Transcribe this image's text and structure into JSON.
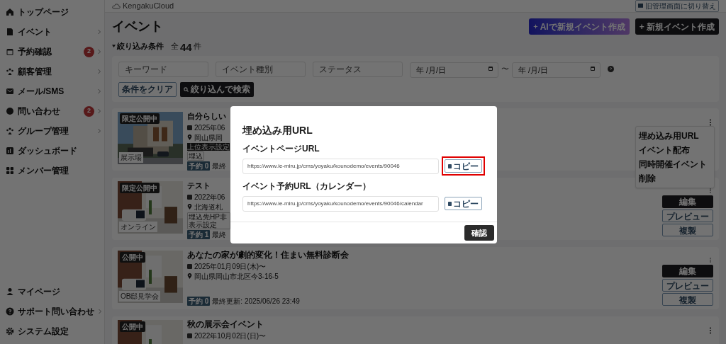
{
  "header": {
    "logo": "KengakuCloud",
    "switch_button": "旧管理画面に切り替え"
  },
  "sidebar": {
    "items": [
      {
        "label": "トップページ",
        "kind": "home",
        "chevron": false
      },
      {
        "label": "イベント",
        "kind": "doc",
        "chevron": true
      },
      {
        "label": "予約確認",
        "kind": "calendar",
        "chevron": true,
        "badge": "2"
      },
      {
        "label": "顧客管理",
        "kind": "users",
        "chevron": true
      },
      {
        "label": "メール/SMS",
        "kind": "mail",
        "chevron": true
      },
      {
        "label": "問い合わせ",
        "kind": "chat",
        "chevron": true,
        "badge": "2"
      },
      {
        "label": "グループ管理",
        "kind": "users",
        "chevron": true
      },
      {
        "label": "ダッシュボード",
        "kind": "chart",
        "chevron": false
      },
      {
        "label": "メンバー管理",
        "kind": "grid",
        "chevron": false
      }
    ],
    "bottom_items": [
      {
        "label": "マイページ",
        "kind": "user",
        "chevron": false
      },
      {
        "label": "サポート問い合わせ",
        "kind": "help",
        "chevron": true
      },
      {
        "label": "システム設定",
        "kind": "gear",
        "chevron": false
      }
    ]
  },
  "page": {
    "title": "イベント",
    "ai_button": "AIで新規イベント作成",
    "new_button": "+ 新規イベント作成",
    "filter_toggle": "絞り込み条件",
    "total_prefix": "全",
    "total": "44",
    "total_suffix": "件"
  },
  "filters": {
    "keyword": {
      "placeholder": "キーワード"
    },
    "event_type": {
      "placeholder": "イベント種別"
    },
    "status": {
      "placeholder": "ステータス"
    },
    "date_from": {
      "placeholder": "年 /月/日"
    },
    "range_sep": "〜",
    "date_to": {
      "placeholder": "年 /月/日"
    },
    "clear_button": "条件をクリア",
    "search_button": "絞り込んで検索"
  },
  "events": [
    {
      "status": "限定公開中",
      "venue": "展示場",
      "title": "自分らしい",
      "date": "2025年06",
      "location": "岡山県岡",
      "tags": [
        {
          "label": "上位表示設定",
          "kind": "dark"
        },
        {
          "label": "埋込",
          "kind": "outline"
        }
      ],
      "reservation": "予約 0",
      "updated": "最終",
      "menu": [
        "埋め込み用URL",
        "イベント配布",
        "同時開催イベント",
        "削除"
      ]
    },
    {
      "status": "限定公開中",
      "venue": "オンライン",
      "title": "テスト",
      "date": "2022年06",
      "location": "北海道札",
      "tags": [
        {
          "label": "埋込先HP非表示設定",
          "kind": "outline"
        }
      ],
      "reservation": "予約 1",
      "updated": "最終",
      "actions": [
        "編集",
        "プレビュー",
        "複製"
      ]
    },
    {
      "status": "公開中",
      "venue": "OB邸見学会",
      "title": "あなたの家が劇的変化！住まい無料診断会",
      "date": "2025年01月09日(木)〜",
      "location": "岡山県岡山市北区今3-16-5",
      "reservation": "予約 0",
      "updated": "最終更新: 2025/06/26 23:49",
      "actions": [
        "編集",
        "プレビュー",
        "複製"
      ]
    },
    {
      "status": "公開中",
      "title": "秋の展示会イベント",
      "date": "2022年10月02日(日)〜"
    }
  ],
  "modal": {
    "title": "埋め込み用URL",
    "fields": [
      {
        "label": "イベントページURL",
        "value": "https://www.ie-miru.jp/cms/yoyaku/kounodemo/events/90046",
        "copy": "コピー",
        "highlighted": true
      },
      {
        "label": "イベント予約URL（カレンダー）",
        "value": "https://www.ie-miru.jp/cms/yoyaku/kounodemo/events/90046/calendar",
        "copy": "コピー",
        "highlighted": false
      }
    ],
    "confirm": "確認"
  }
}
